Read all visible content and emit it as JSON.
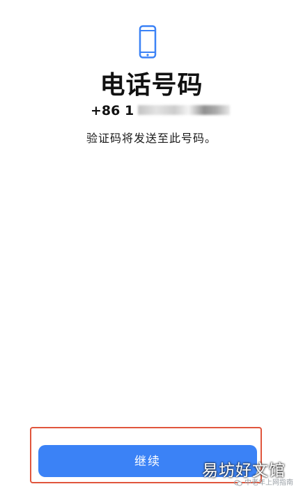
{
  "header": {
    "icon": "phone-icon",
    "title": "电话号码",
    "phone_prefix": "+86 1",
    "subtitle": "验证码将发送至此号码。"
  },
  "footer": {
    "continue_label": "继续"
  },
  "watermark": {
    "main_text": "易坊好文馆",
    "small_icon": "wechat-icon",
    "small_text": "中老年上网指南"
  },
  "colors": {
    "accent": "#3b82f6",
    "highlight_border": "#e0553c",
    "text": "#111111",
    "background": "#ffffff"
  }
}
